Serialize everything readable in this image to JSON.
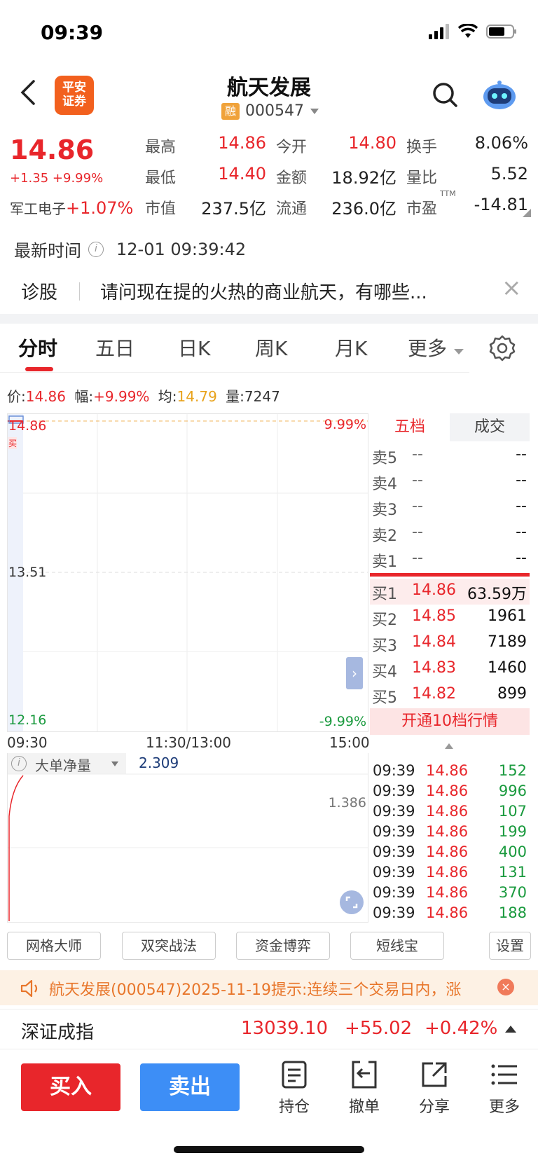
{
  "status_bar": {
    "time": "09:39"
  },
  "header": {
    "logo_line1": "平安",
    "logo_line2": "证券",
    "name": "航天发展",
    "rong": "融",
    "code": "000547"
  },
  "quote": {
    "price": "14.86",
    "change": "+1.35",
    "change_pct": "+9.99%",
    "sector_name": "军工电子",
    "sector_pct": "+1.07%",
    "high_label": "最高",
    "high": "14.86",
    "open_label": "今开",
    "open": "14.80",
    "turnover_label": "换手",
    "turnover": "8.06%",
    "low_label": "最低",
    "low": "14.40",
    "amount_label": "金额",
    "amount": "18.92亿",
    "vol_ratio_label": "量比",
    "vol_ratio": "5.52",
    "mcap_label": "市值",
    "mcap": "237.5亿",
    "float_label": "流通",
    "float": "236.0亿",
    "pe_label": "市盈",
    "pe_sup": "TTM",
    "pe": "-14.81"
  },
  "latest_time": {
    "label": "最新时间",
    "value": "12-01 09:39:42"
  },
  "diagnosis": {
    "label": "诊股",
    "text": "请问现在提的火热的商业航天，有哪些..."
  },
  "tabs": [
    "分时",
    "五日",
    "日K",
    "周K",
    "月K",
    "更多"
  ],
  "info_line": {
    "price_label": "价:",
    "price": "14.86",
    "amp_label": "幅:",
    "amp": "+9.99%",
    "avg_label": "均:",
    "avg": "14.79",
    "vol_label": "量:",
    "vol": "7247"
  },
  "chart": {
    "y_top": "14.86",
    "y_mid": "13.51",
    "y_bot": "12.16",
    "pct_top": "9.99%",
    "pct_bot": "-9.99%",
    "time_start": "09:30",
    "time_mid": "11:30/13:00",
    "time_end": "15:00",
    "buy_marker": "买"
  },
  "sub_chart": {
    "indicator": "大单净量",
    "value": "2.309",
    "axis_value": "1.386"
  },
  "book": {
    "tab_five": "五档",
    "tab_trades": "成交",
    "asks": [
      {
        "label": "卖5",
        "price": "--",
        "vol": "--"
      },
      {
        "label": "卖4",
        "price": "--",
        "vol": "--"
      },
      {
        "label": "卖3",
        "price": "--",
        "vol": "--"
      },
      {
        "label": "卖2",
        "price": "--",
        "vol": "--"
      },
      {
        "label": "卖1",
        "price": "--",
        "vol": "--"
      }
    ],
    "bids": [
      {
        "label": "买1",
        "price": "14.86",
        "vol": "63.59万"
      },
      {
        "label": "买2",
        "price": "14.85",
        "vol": "1961"
      },
      {
        "label": "买3",
        "price": "14.84",
        "vol": "7189"
      },
      {
        "label": "买4",
        "price": "14.83",
        "vol": "1460"
      },
      {
        "label": "买5",
        "price": "14.82",
        "vol": "899"
      }
    ],
    "open_ten": "开通10档行情"
  },
  "trades": [
    {
      "time": "09:39",
      "price": "14.86",
      "vol": "152"
    },
    {
      "time": "09:39",
      "price": "14.86",
      "vol": "996"
    },
    {
      "time": "09:39",
      "price": "14.86",
      "vol": "107"
    },
    {
      "time": "09:39",
      "price": "14.86",
      "vol": "199"
    },
    {
      "time": "09:39",
      "price": "14.86",
      "vol": "400"
    },
    {
      "time": "09:39",
      "price": "14.86",
      "vol": "131"
    },
    {
      "time": "09:39",
      "price": "14.86",
      "vol": "370"
    },
    {
      "time": "09:39",
      "price": "14.86",
      "vol": "188"
    }
  ],
  "strategies": [
    "网格大师",
    "双突战法",
    "资金博弈",
    "短线宝",
    "设置"
  ],
  "alert": {
    "text": "航天发展(000547)2025-11-19提示:连续三个交易日内，涨"
  },
  "index": {
    "name": "深证成指",
    "value": "13039.10",
    "change": "+55.02",
    "pct": "+0.42%"
  },
  "bottom": {
    "buy": "买入",
    "sell": "卖出",
    "hold": "持仓",
    "cancel": "撤单",
    "share": "分享",
    "more": "更多"
  },
  "colors": {
    "up": "#e8262b",
    "down": "#1a9a3e",
    "accent_blue": "#3d8ef6",
    "logo_orange": "#f2601e"
  }
}
